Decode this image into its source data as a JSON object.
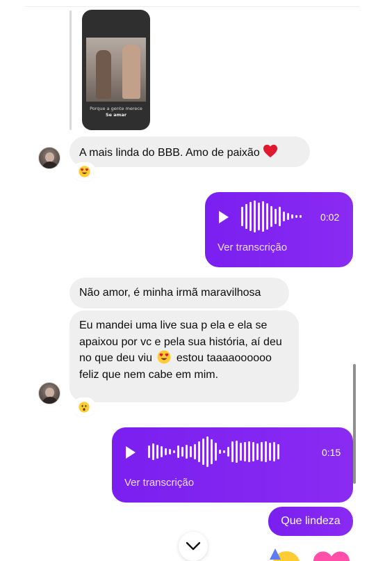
{
  "thread": {
    "story_reply": {
      "caption_line1": "Porque a gente merece",
      "caption_line2": "Se amar"
    },
    "msg1": {
      "text": "A mais linda do BBB. Amo de paixão",
      "reaction": "heart-eyes-emoji"
    },
    "voice1": {
      "duration": "0:02",
      "transcribe_label": "Ver transcrição"
    },
    "msg2": {
      "text": "Não amor, é minha irmã maravilhosa"
    },
    "msg3": {
      "text_before": "Eu mandei uma live sua p ela e ela se apaixou por vc e pela sua história, aí deu no que deu viu",
      "text_after": "estou taaaaoooooo feliz que nem cabe em mim.",
      "reaction": "hushed-face-emoji"
    },
    "voice2": {
      "duration": "0:15",
      "transcribe_label": "Ver transcrição"
    },
    "msg4": {
      "text": "Que lindeza"
    }
  },
  "colors": {
    "outgoing_bubble": "#7a1ff0",
    "incoming_bubble": "#efefef",
    "heart": "#e0192f"
  }
}
